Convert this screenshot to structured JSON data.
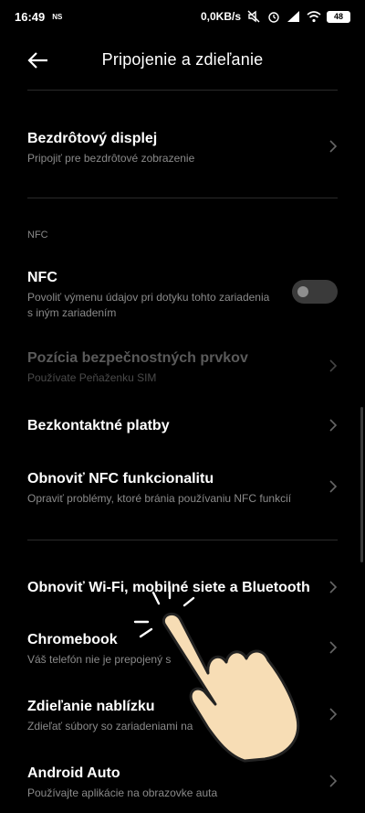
{
  "status": {
    "time": "16:49",
    "carrier_badge": "NS",
    "net_speed": "0,0KB/s",
    "battery": "48",
    "icons": [
      "mute-icon",
      "alarm-icon",
      "signal-icon",
      "wifi-icon",
      "battery-icon"
    ]
  },
  "header": {
    "title": "Pripojenie a zdieľanie",
    "back_icon": "arrow-left-icon"
  },
  "items": [
    {
      "title": "Bezdrôtový displej",
      "subtitle": "Pripojiť pre bezdrôtové zobrazenie"
    },
    {
      "title": "NFC",
      "subtitle_line1": "Povoliť výmenu údajov pri dotyku tohto zariadenia",
      "subtitle_line2": "s iným zariadením",
      "toggle_on": false
    },
    {
      "title": "Pozícia bezpečnostných prvkov",
      "subtitle": "Používate Peňaženku SIM",
      "disabled": true
    },
    {
      "title": "Bezkontaktné platby"
    },
    {
      "title": "Obnoviť NFC funkcionalitu",
      "subtitle": "Opraviť problémy, ktoré bránia používaniu NFC funkcií"
    },
    {
      "title": "Obnoviť Wi-Fi, mobilné siete a Bluetooth"
    },
    {
      "title": "Chromebook",
      "subtitle": "Váš telefón nie je prepojený s"
    },
    {
      "title": "Zdieľanie nablízku",
      "subtitle": "Zdieľať súbory so zariadeniami na"
    },
    {
      "title": "Android Auto",
      "subtitle": "Používajte aplikácie na obrazovke auta"
    }
  ],
  "sections": {
    "nfc_label": "NFC"
  },
  "colors": {
    "background": "#000000",
    "text": "#ffffff",
    "subtext": "#8a8a8a",
    "disabled": "#5a5a5a",
    "hand_fill": "#f7ddb5"
  }
}
